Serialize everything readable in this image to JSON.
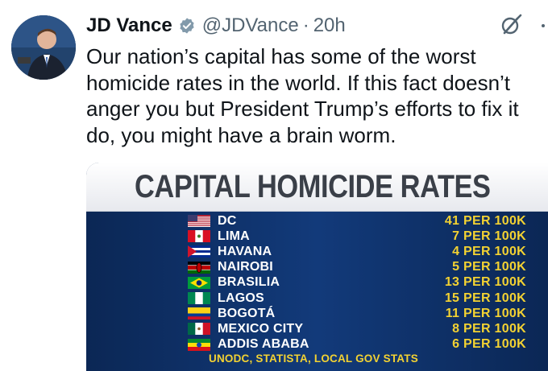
{
  "author": {
    "name": "JD Vance",
    "handle": "@JDVance",
    "separator": "·",
    "time": "20h",
    "avatar_icon": "profile-photo-avatar",
    "verified_icon": "verified-badge-icon",
    "verified_color": "#829aab"
  },
  "actions": {
    "grok_icon": "grok-slash-icon",
    "more_icon": "more-dots-icon"
  },
  "tweet": {
    "text": "Our nation’s capital has some of the worst homicide rates in the world. If this fact doesn’t anger you but President Trump’s efforts to fix it do, you might have a brain worm."
  },
  "media": {
    "title": "CAPITAL HOMICIDE RATES",
    "rows": [
      {
        "city": "DC",
        "rate": "41 PER 100K",
        "flag": "us-flag-icon"
      },
      {
        "city": "LIMA",
        "rate": "7 PER 100K",
        "flag": "peru-flag-icon"
      },
      {
        "city": "HAVANA",
        "rate": "4 PER 100K",
        "flag": "cuba-flag-icon"
      },
      {
        "city": "NAIROBI",
        "rate": "5 PER 100K",
        "flag": "kenya-flag-icon"
      },
      {
        "city": "BRASILIA",
        "rate": "13 PER 100K",
        "flag": "brazil-flag-icon"
      },
      {
        "city": "LAGOS",
        "rate": "15 PER 100K",
        "flag": "nigeria-flag-icon"
      },
      {
        "city": "BOGOTÁ",
        "rate": "11 PER 100K",
        "flag": "colombia-flag-icon"
      },
      {
        "city": "MEXICO CITY",
        "rate": "8 PER 100K",
        "flag": "mexico-flag-icon"
      },
      {
        "city": "ADDIS ABABA",
        "rate": "6 PER 100K",
        "flag": "ethiopia-flag-icon"
      }
    ],
    "source": "UNODC, STATISTA, LOCAL GOV STATS",
    "colors": {
      "background": "#0c2a5a",
      "rate": "#f3d232",
      "city": "#ffffff",
      "title": "#3a3f48"
    }
  }
}
